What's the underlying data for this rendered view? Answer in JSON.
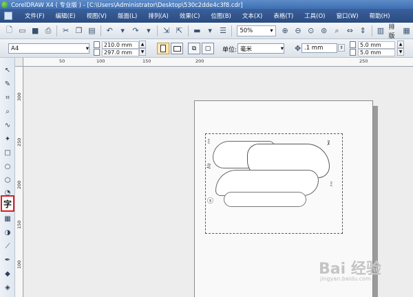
{
  "window": {
    "title": "CorelDRAW X4 ( 专业版 ) - [C:\\Users\\Administrator\\Desktop\\530c2dde4c3f8.cdr]"
  },
  "menubar": {
    "items": [
      "文件(F)",
      "编辑(E)",
      "视图(V)",
      "版面(L)",
      "排列(A)",
      "效果(C)",
      "位图(B)",
      "文本(X)",
      "表格(T)",
      "工具(O)",
      "窗口(W)",
      "帮助(H)"
    ]
  },
  "toolbar": {
    "zoom_value": "50%",
    "arrange_label": "排版"
  },
  "property_bar": {
    "paper_size": "A4",
    "width": "210.0 mm",
    "height": "297.0 mm",
    "units_label": "单位:",
    "units_value": "毫米",
    "nudge": ".1 mm",
    "duplicate_x": "5.0 mm",
    "duplicate_y": "5.0 mm"
  },
  "ruler": {
    "top_labels": [
      "50",
      "100",
      "150",
      "200",
      "250"
    ],
    "left_labels": [
      "300",
      "250",
      "200",
      "150",
      "100"
    ]
  },
  "watermark": {
    "main": "Bai 经验",
    "sub": "jingyan.baidu.com"
  },
  "colors": {
    "accent": "#e01a1a",
    "titlebar": "#3e6fb3",
    "menubar": "#2b4c82"
  }
}
